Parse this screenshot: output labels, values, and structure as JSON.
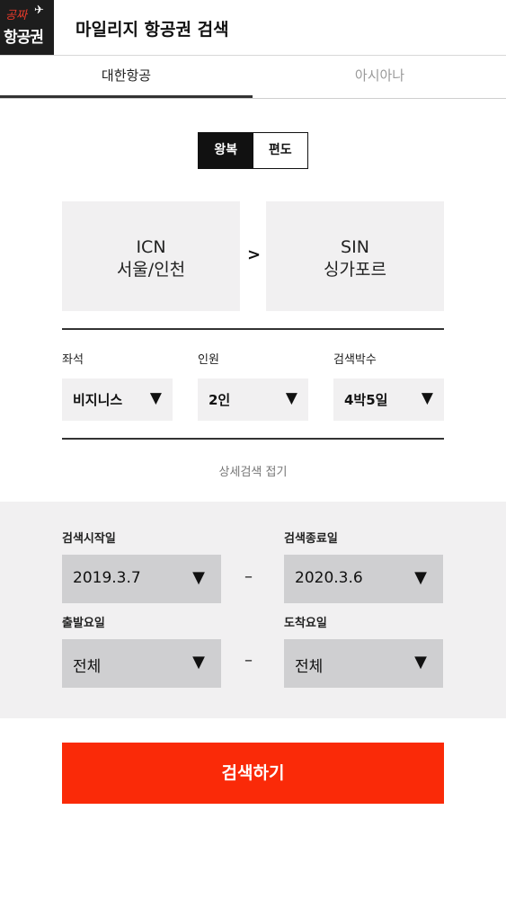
{
  "header": {
    "logo_line1": "공짜",
    "logo_line2": "항공권",
    "logo_icon": "airplane-icon",
    "title": "마일리지 항공권 검색"
  },
  "tabs": [
    {
      "label": "대한항공",
      "active": true
    },
    {
      "label": "아시아나",
      "active": false
    }
  ],
  "trip_type": {
    "options": [
      "왕복",
      "편도"
    ],
    "selected": "왕복"
  },
  "route": {
    "from": {
      "code": "ICN",
      "name": "서울/인천"
    },
    "arrow": ">",
    "to": {
      "code": "SIN",
      "name": "싱가포르"
    }
  },
  "options": {
    "seat": {
      "label": "좌석",
      "value": "비지니스",
      "caret": "▼"
    },
    "passengers": {
      "label": "인원",
      "value": "2인",
      "caret": "▼"
    },
    "stay": {
      "label": "검색박수",
      "value": "4박5일",
      "caret": "▼"
    }
  },
  "collapse_link": "상세검색 접기",
  "detail": {
    "start_date": {
      "label": "검색시작일",
      "value": "2019.3.7"
    },
    "end_date": {
      "label": "검색종료일",
      "value": "2020.3.6"
    },
    "dep_day": {
      "label": "출발요일",
      "value": "전체"
    },
    "arr_day": {
      "label": "도착요일",
      "value": "전체"
    },
    "dash": "–",
    "caret": "▼"
  },
  "search_button": "검색하기",
  "colors": {
    "accent": "#fa2a08",
    "panel": "#f1f0f1",
    "select_dark": "#cfcfd1",
    "logo_bg": "#1d1d1d",
    "logo_red": "#e53a2a"
  }
}
